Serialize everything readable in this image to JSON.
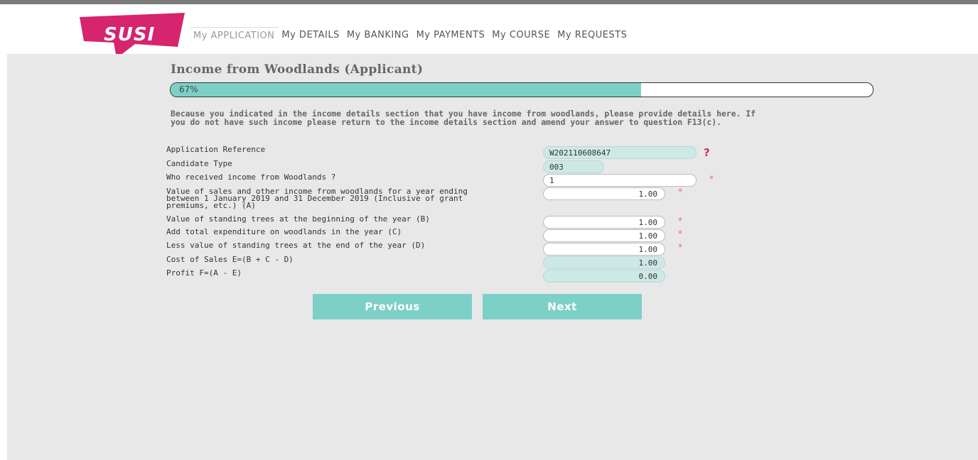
{
  "logo_text": "SUSI",
  "nav": [
    {
      "label": "My APPLICATION",
      "active": true
    },
    {
      "label": "My DETAILS",
      "active": false
    },
    {
      "label": "My BANKING",
      "active": false
    },
    {
      "label": "My PAYMENTS",
      "active": false
    },
    {
      "label": "My COURSE",
      "active": false
    },
    {
      "label": "My REQUESTS",
      "active": false
    }
  ],
  "page": {
    "title": "Income from Woodlands (Applicant)",
    "progress_label": "67%",
    "progress_fraction": 0.67,
    "intro_line1": "Because you indicated in the income details section that you have income from woodlands, please provide details here. If",
    "intro_line2": "you do not have such income please return to the income details section and amend your answer to question F13(c)."
  },
  "form": {
    "app_ref": {
      "label": "Application Reference",
      "value": "W202110608647"
    },
    "candidate_type": {
      "label": "Candidate Type",
      "value": "003"
    },
    "who_received": {
      "label": "Who received income from Woodlands ?",
      "value": "1"
    },
    "sales_value": {
      "label_line1": "Value of sales and other income from woodlands for a year ending",
      "label_line2": "between 1 January 2019 and 31 December 2019 (Inclusive of grant",
      "label_line3": "premiums, etc.) (A)",
      "value": "1.00"
    },
    "trees_begin": {
      "label": "Value of standing trees at the beginning of the year (B)",
      "value": "1.00"
    },
    "expenditure": {
      "label": "Add total expenditure on woodlands in the year (C)",
      "value": "1.00"
    },
    "trees_end": {
      "label": "Less value of standing trees at the end of the year (D)",
      "value": "1.00"
    },
    "cost_of_sales": {
      "label": "Cost of Sales E=(B + C - D)",
      "value": "1.00"
    },
    "profit": {
      "label": "Profit F=(A - E)",
      "value": "0.00"
    }
  },
  "required_marker": "*",
  "help_marker": "?",
  "buttons": {
    "previous": "Previous",
    "next": "Next"
  },
  "colors": {
    "brand_pink": "#d6246e",
    "accent_teal": "#7dd0c8",
    "readonly_field": "#cde9e6"
  }
}
